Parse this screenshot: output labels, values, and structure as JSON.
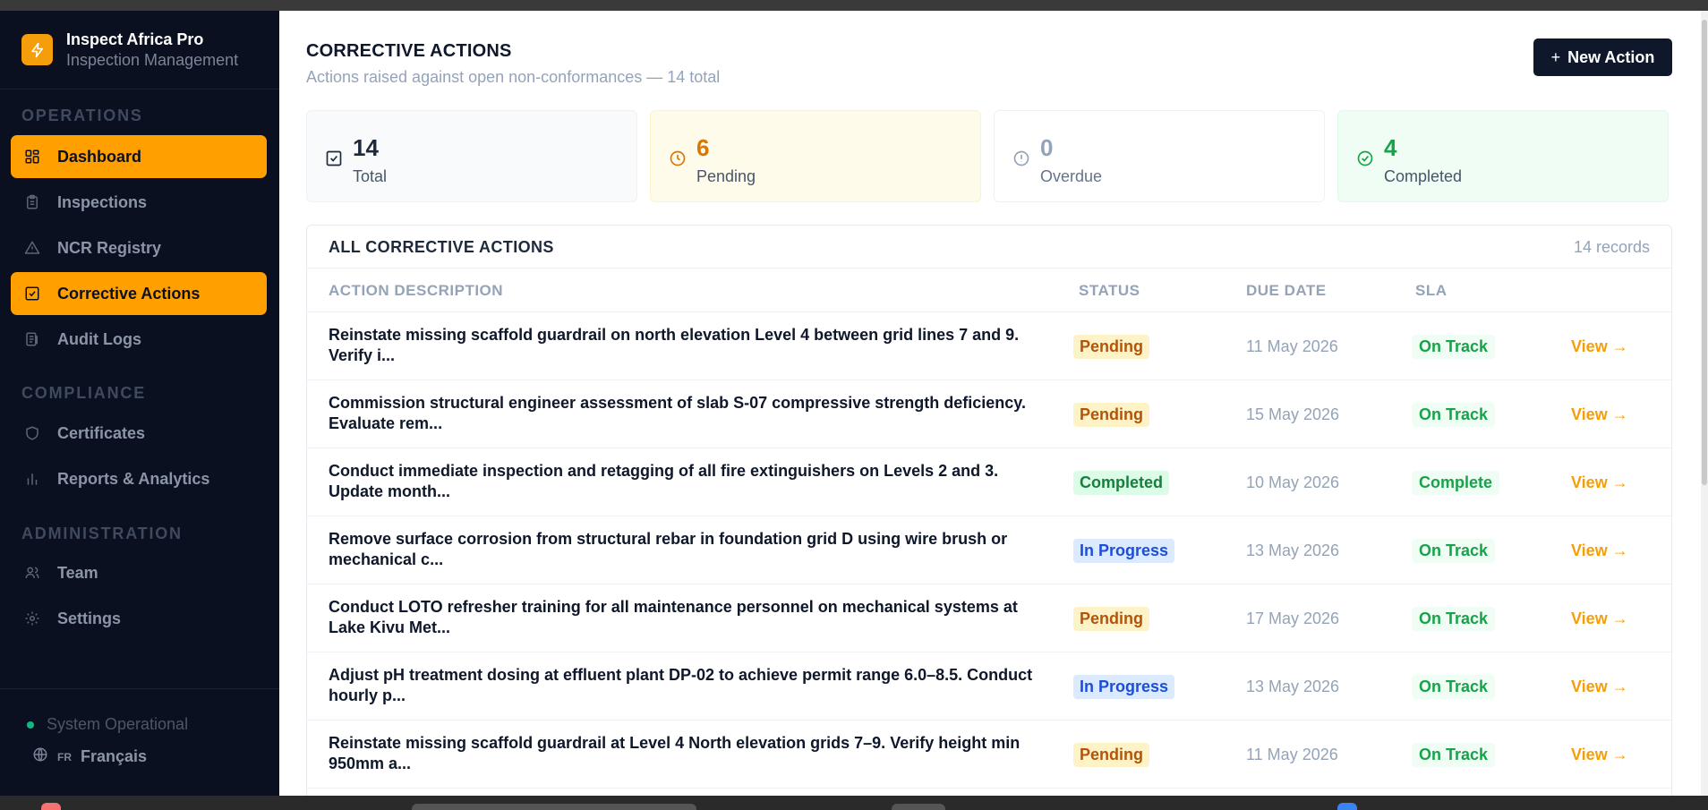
{
  "brand": {
    "title": "Inspect Africa Pro",
    "subtitle": "Inspection Management"
  },
  "sidebar": {
    "sections": [
      {
        "label": "OPERATIONS"
      },
      {
        "label": "COMPLIANCE"
      },
      {
        "label": "ADMINISTRATION"
      }
    ],
    "items": [
      {
        "label": "Dashboard",
        "icon": "grid-icon",
        "active": true
      },
      {
        "label": "Inspections",
        "icon": "clipboard-icon",
        "active": false
      },
      {
        "label": "NCR Registry",
        "icon": "warning-icon",
        "active": false
      },
      {
        "label": "Corrective Actions",
        "icon": "check-square-icon",
        "active": true
      },
      {
        "label": "Audit Logs",
        "icon": "log-icon",
        "active": false
      },
      {
        "label": "Certificates",
        "icon": "shield-icon",
        "active": false
      },
      {
        "label": "Reports & Analytics",
        "icon": "bar-chart-icon",
        "active": false
      },
      {
        "label": "Team",
        "icon": "users-icon",
        "active": false
      },
      {
        "label": "Settings",
        "icon": "gear-icon",
        "active": false
      }
    ],
    "footer": {
      "status": "System Operational",
      "lang_code": "FR",
      "lang_label": "Français"
    }
  },
  "header": {
    "title": "CORRECTIVE ACTIONS",
    "subtitle": "Actions raised against open non-conformances — 14 total",
    "new_button": "New Action"
  },
  "stats": [
    {
      "value": "14",
      "label": "Total"
    },
    {
      "value": "6",
      "label": "Pending"
    },
    {
      "value": "0",
      "label": "Overdue"
    },
    {
      "value": "4",
      "label": "Completed"
    }
  ],
  "colors": {
    "accent": "#ff9f00",
    "sidebar_bg": "#0b1020",
    "pending": "#b45309",
    "completed": "#15803d",
    "in_progress": "#1d4ed8"
  },
  "table": {
    "title": "ALL CORRECTIVE ACTIONS",
    "count": "14 records",
    "columns": [
      "ACTION DESCRIPTION",
      "STATUS",
      "DUE DATE",
      "SLA"
    ],
    "view_label": "View →",
    "rows": [
      {
        "description": "Reinstate missing scaffold guardrail on north elevation Level 4 between grid lines 7 and 9. Verify i...",
        "status": "Pending",
        "due": "11 May 2026",
        "sla": "On Track"
      },
      {
        "description": "Commission structural engineer assessment of slab S-07 compressive strength deficiency. Evaluate rem...",
        "status": "Pending",
        "due": "15 May 2026",
        "sla": "On Track"
      },
      {
        "description": "Conduct immediate inspection and retagging of all fire extinguishers on Levels 2 and 3. Update month...",
        "status": "Completed",
        "due": "10 May 2026",
        "sla": "Complete"
      },
      {
        "description": "Remove surface corrosion from structural rebar in foundation grid D using wire brush or mechanical c...",
        "status": "In Progress",
        "due": "13 May 2026",
        "sla": "On Track"
      },
      {
        "description": "Conduct LOTO refresher training for all maintenance personnel on mechanical systems at Lake Kivu Met...",
        "status": "Pending",
        "due": "17 May 2026",
        "sla": "On Track"
      },
      {
        "description": "Adjust pH treatment dosing at effluent plant DP-02 to achieve permit range 6.0–8.5. Conduct hourly p...",
        "status": "In Progress",
        "due": "13 May 2026",
        "sla": "On Track"
      },
      {
        "description": "Reinstate missing scaffold guardrail at Level 4 North elevation grids 7–9. Verify height min 950mm a...",
        "status": "Pending",
        "due": "11 May 2026",
        "sla": "On Track"
      }
    ]
  }
}
